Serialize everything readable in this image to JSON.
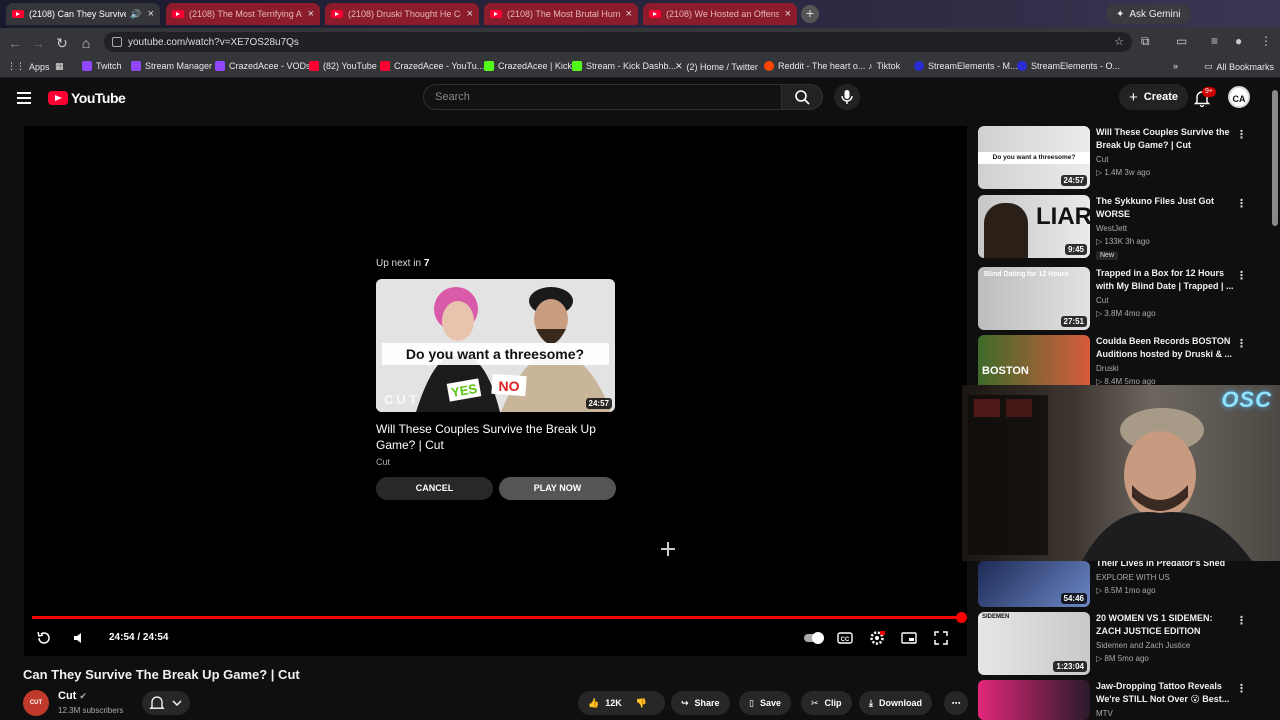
{
  "browser": {
    "tabs": [
      {
        "title": "(2108) Can They Survive Th...",
        "active": true
      },
      {
        "title": "(2108) The Most Terrifying Avi...",
        "active": false
      },
      {
        "title": "(2108) Druski Thought He Cou...",
        "active": false
      },
      {
        "title": "(2108) The Most Brutal Human...",
        "active": false
      },
      {
        "title": "(2108) We Hosted an Offensiv...",
        "active": false
      }
    ],
    "gemini_label": "Ask Gemini",
    "url": "youtube.com/watch?v=XE7OS28u7Qs",
    "bookmarks": [
      "Apps",
      "Twitch",
      "Stream Manager",
      "CrazedAcee - VODs",
      "(82) YouTube",
      "CrazedAcee - YouTu...",
      "CrazedAcee | Kick",
      "Stream - Kick Dashb...",
      "(2) Home / Twitter",
      "Reddit - The heart o...",
      "Tiktok",
      "StreamElements - M...",
      "StreamElements - O..."
    ],
    "all_bookmarks": "All Bookmarks"
  },
  "header": {
    "logo_text": "YouTube",
    "search_placeholder": "Search",
    "create_label": "Create",
    "notif_count": "9+",
    "avatar_text": "CA"
  },
  "player": {
    "upnext_prefix": "Up next in",
    "upnext_seconds": "7",
    "card": {
      "title": "Will These Couples Survive the Break Up Game? | Cut",
      "channel": "Cut",
      "duration": "24:57",
      "thumb_text": "Do you want a threesome?",
      "yes": "YES",
      "no": "NO",
      "brand": "CUT"
    },
    "cancel_label": "CANCEL",
    "play_label": "PLAY NOW",
    "time": "24:54 / 24:54",
    "progress": 1.0
  },
  "video": {
    "title": "Can They Survive The Break Up Game? | Cut",
    "channel": "Cut",
    "subscribers": "12.3M subscribers",
    "channel_avatar_text": "CUT",
    "likes": "12K",
    "share_label": "Share",
    "save_label": "Save",
    "clip_label": "Clip",
    "download_label": "Download"
  },
  "recommendations": [
    {
      "title": "Will These Couples Survive the Break Up Game? | Cut",
      "channel": "Cut",
      "meta": "▷ 1.4M  3w ago",
      "duration": "24:57",
      "thumb_text": "Do you want a threesome?"
    },
    {
      "title": "The Sykkuno Files Just Got WORSE",
      "channel": "WestJett",
      "meta": "▷ 133K  3h ago",
      "duration": "9:45",
      "badge": "New",
      "thumb_text": "LIAR"
    },
    {
      "title": "Trapped in a Box for 12 Hours with My Blind Date | Trapped | ...",
      "channel": "Cut",
      "meta": "▷ 3.8M  4mo ago",
      "duration": "27:51",
      "thumb_text": "Blind Dating for 12 Hours"
    },
    {
      "title": "Coulda Been Records BOSTON Auditions hosted by Druski & ...",
      "channel": "Druski",
      "meta": "▷ 8.4M  5mo ago",
      "duration": "",
      "thumb_text": "BOSTON"
    },
    {
      "title": "Their Lives in Predator's Shed",
      "channel": "EXPLORE WITH US",
      "meta": "▷ 8.5M  1mo ago",
      "duration": "54:46",
      "thumb_text": ""
    },
    {
      "title": "20 WOMEN VS 1 SIDEMEN: ZACH JUSTICE EDITION",
      "channel": "Sidemen and Zach Justice",
      "meta": "▷ 8M  5mo ago",
      "duration": "1:23:04",
      "thumb_text": "SIDEMEN"
    },
    {
      "title": "Jaw-Dropping Tattoo Reveals We're STILL Not Over 😮 Best...",
      "channel": "MTV",
      "meta": "",
      "duration": "",
      "thumb_text": ""
    }
  ],
  "webcam": {
    "logo": "OSC"
  },
  "colors": {
    "brand_red": "#ff0033",
    "progress": "#ff0000",
    "bg": "#0f0f0f"
  }
}
